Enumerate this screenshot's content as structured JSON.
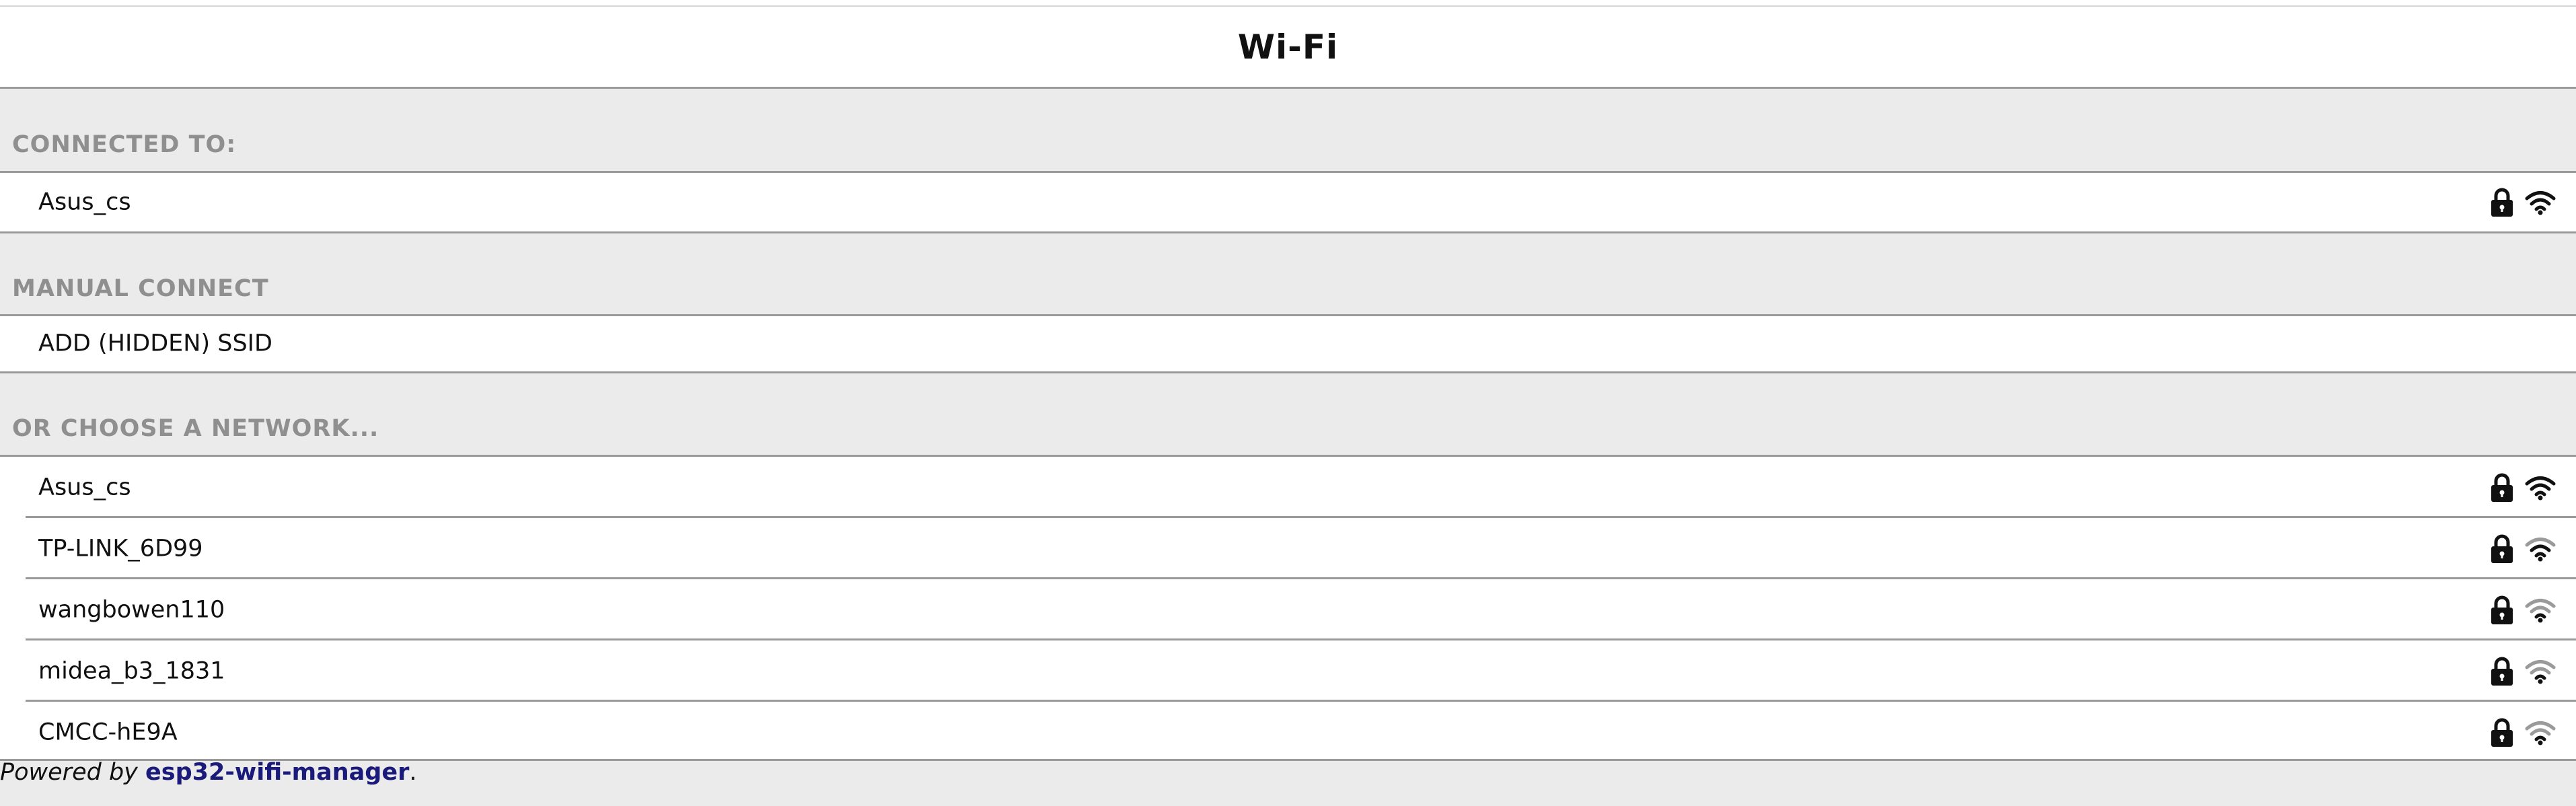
{
  "header": {
    "title": "Wi-Fi"
  },
  "connected": {
    "title": "CONNECTED TO:",
    "network": {
      "ssid": "Asus_cs",
      "secured": true,
      "signal_bars": 3
    }
  },
  "manual": {
    "title": "MANUAL CONNECT",
    "add_label": "ADD (HIDDEN) SSID"
  },
  "networks": {
    "title": "OR CHOOSE A NETWORK...",
    "items": [
      {
        "ssid": "Asus_cs",
        "secured": true,
        "signal_bars": 3
      },
      {
        "ssid": "TP-LINK_6D99",
        "secured": true,
        "signal_bars": 2
      },
      {
        "ssid": "wangbowen110",
        "secured": true,
        "signal_bars": 1
      },
      {
        "ssid": "midea_b3_1831",
        "secured": true,
        "signal_bars": 1
      },
      {
        "ssid": "CMCC-hE9A",
        "secured": true,
        "signal_bars": 1
      }
    ]
  },
  "footer": {
    "prefix": "Powered by",
    "link_text": "esp32-wifi-manager",
    "suffix": "."
  },
  "icons": {
    "lock": "lock-icon",
    "wifi": "wifi-signal-icon"
  },
  "colors": {
    "active": "#111111",
    "inactive": "#9a9a9a",
    "link": "#1a1a7a",
    "section_bg": "#ebebeb"
  }
}
